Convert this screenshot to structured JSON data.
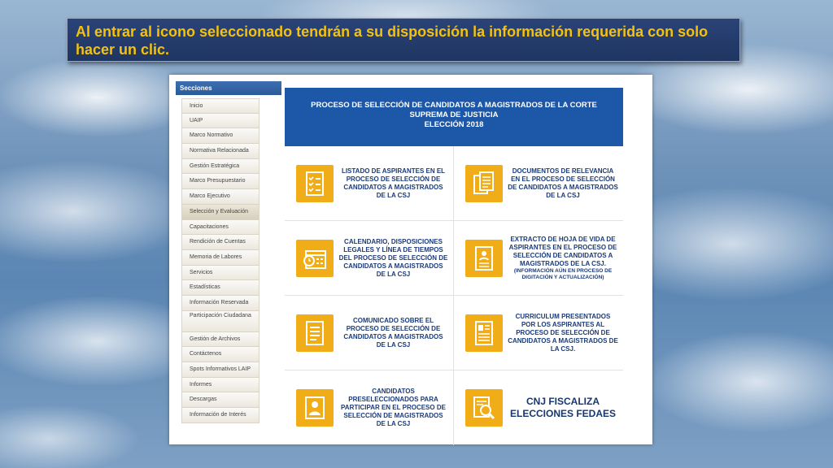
{
  "banner": {
    "text": "Al entrar al icono seleccionado tendrán a su disposición la información requerida con solo hacer un clic."
  },
  "sidebar": {
    "title": "Secciones",
    "items": [
      {
        "label": "Inicio"
      },
      {
        "label": "UAIP"
      },
      {
        "label": "Marco Normativo"
      },
      {
        "label": "Normativa Relacionada"
      },
      {
        "label": "Gestión Estratégica"
      },
      {
        "label": "Marco Presupuestario"
      },
      {
        "label": "Marco Ejecutivo"
      },
      {
        "label": "Selección y Evaluación"
      },
      {
        "label": "Capacitaciones"
      },
      {
        "label": "Rendición de Cuentas"
      },
      {
        "label": "Memoria de Labores"
      },
      {
        "label": "Servicios"
      },
      {
        "label": "Estadísticas"
      },
      {
        "label": "Información Reservada"
      },
      {
        "label": "Participación Ciudadana"
      },
      {
        "label": "Gestión de Archivos"
      },
      {
        "label": "Contáctenos"
      },
      {
        "label": "Spots Informativos LAIP"
      },
      {
        "label": "Informes"
      },
      {
        "label": "Descargas"
      },
      {
        "label": "Información de Interés"
      }
    ]
  },
  "header": {
    "line1": "PROCESO DE SELECCIÓN DE CANDIDATOS A MAGISTRADOS DE LA CORTE",
    "line2": "SUPREMA DE JUSTICIA",
    "line3": "ELECCIÓN 2018"
  },
  "cards": [
    {
      "label": "LISTADO DE ASPIRANTES EN EL PROCESO DE SELECCIÓN DE CANDIDATOS A MAGISTRADOS DE LA CSJ",
      "icon": "checklist-icon"
    },
    {
      "label": "DOCUMENTOS DE RELEVANCIA EN EL PROCESO DE SELECCIÓN DE CANDIDATOS A MAGISTRADOS DE LA CSJ",
      "icon": "documents-icon"
    },
    {
      "label": "CALENDARIO, DISPOSICIONES LEGALES Y LÍNEA DE TIEMPOS DEL PROCESO DE SELECCIÓN DE CANDIDATOS A MAGISTRADOS DE LA CSJ",
      "icon": "calendar-icon"
    },
    {
      "label": "EXTRACTO DE HOJA DE VIDA DE ASPIRANTES EN EL PROCESO DE SELECCIÓN DE CANDIDATOS A MAGISTRADOS DE LA CSJ.",
      "note": "(INFORMACIÓN AÚN EN PROCESO DE DIGITACIÓN Y ACTUALIZACIÓN)",
      "icon": "resume-icon"
    },
    {
      "label": "COMUNICADO SOBRE EL PROCESO DE SELECCIÓN DE CANDIDATOS A MAGISTRADOS DE LA CSJ",
      "icon": "announcement-icon"
    },
    {
      "label": "CURRICULUM PRESENTADOS POR LOS ASPIRANTES AL PROCESO DE SELECCIÓN DE CANDIDATOS A MAGISTRADOS DE LA CSJ.",
      "icon": "curriculum-icon"
    },
    {
      "label": "CANDIDATOS PRESELECCIONADOS PARA PARTICIPAR EN EL PROCESO DE SELECCIÓN DE MAGISTRADOS DE LA CSJ",
      "icon": "candidate-icon"
    },
    {
      "label": "CNJ FISCALIZA ELECCIONES FEDAES",
      "icon": "audit-icon"
    }
  ],
  "colors": {
    "tile": "#f0ad18",
    "header": "#1d57a7",
    "banner_text": "#f4c20d"
  }
}
